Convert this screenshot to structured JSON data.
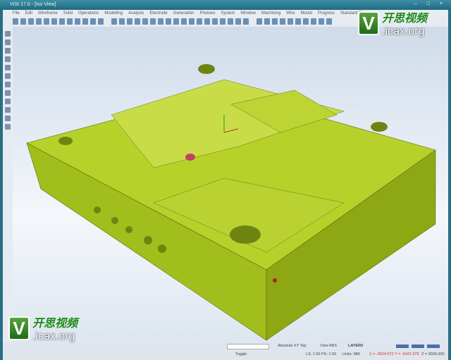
{
  "window": {
    "title": "VISI 17.0 - [Iso View]",
    "controls": "– □ ×"
  },
  "menu": [
    "File",
    "Edit",
    "Wireframe",
    "Solid",
    "Operations",
    "Modelling",
    "Analysis",
    "Electrode",
    "Generation",
    "Photoes",
    "System",
    "Window",
    "Machining",
    "Wire",
    "Mould",
    "Progress",
    "Standard Elements"
  ],
  "status": {
    "view_name": "Absolute XY Top",
    "view_abs": "View ABS",
    "layer": "LAYER0",
    "toggle": "Toggle",
    "scale": "LS: 1.00 PS: 1.00",
    "units": "Units: MM",
    "coords_xy": "X = -0524.072 Y = -0437.070",
    "coord_z": "Z = 0000.000"
  },
  "watermark": {
    "cn": "开思视频",
    "url": ".icax.org",
    "v": "V"
  },
  "colors": {
    "model": "#a8c81e",
    "accent": "#1f8a1a"
  }
}
